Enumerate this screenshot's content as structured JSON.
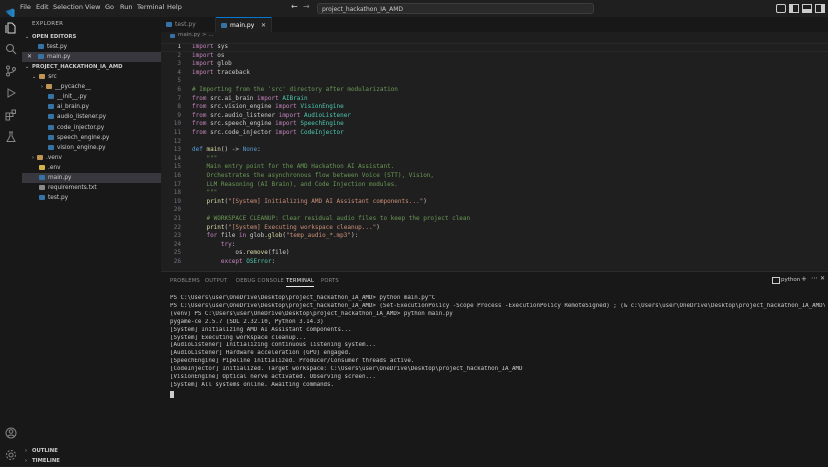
{
  "menu": [
    "File",
    "Edit",
    "Selection",
    "View",
    "Go",
    "Run",
    "Terminal",
    "Help"
  ],
  "search": {
    "text": "project_hackathon_IA_AMD"
  },
  "sidebar": {
    "title": "EXPLORER",
    "open_editors_label": "OPEN EDITORS",
    "open_editors": [
      {
        "label": "test.py",
        "color": "#3572a5"
      },
      {
        "label": "main.py",
        "color": "#3572a5"
      }
    ],
    "project_label": "PROJECT_HACKATHON_IA_AMD",
    "tree": [
      {
        "label": "src",
        "kind": "folder-open",
        "depth": 0
      },
      {
        "label": "__pycache__",
        "kind": "folder",
        "depth": 1
      },
      {
        "label": "__init__.py",
        "kind": "py",
        "depth": 1
      },
      {
        "label": "ai_brain.py",
        "kind": "py",
        "depth": 1
      },
      {
        "label": "audio_listener.py",
        "kind": "py",
        "depth": 1
      },
      {
        "label": "code_injector.py",
        "kind": "py",
        "depth": 1
      },
      {
        "label": "speech_engine.py",
        "kind": "py",
        "depth": 1
      },
      {
        "label": "vision_engine.py",
        "kind": "py",
        "depth": 1
      },
      {
        "label": ".venv",
        "kind": "folder",
        "depth": 0
      },
      {
        "label": ".env",
        "kind": "env",
        "depth": 0
      },
      {
        "label": "main.py",
        "kind": "py",
        "depth": 0
      },
      {
        "label": "requirements.txt",
        "kind": "txt",
        "depth": 0
      },
      {
        "label": "test.py",
        "kind": "py",
        "depth": 0
      }
    ],
    "outline_label": "OUTLINE",
    "timeline_label": "TIMELINE"
  },
  "tabs": [
    {
      "label": "test.py",
      "active": false
    },
    {
      "label": "main.py",
      "active": true
    }
  ],
  "breadcrumb": "main.py > ...",
  "editor": {
    "line_numbers": [
      "1",
      "2",
      "3",
      "4",
      "5",
      "6",
      "7",
      "8",
      "9",
      "10",
      "11",
      "12",
      "13",
      "14",
      "15",
      "16",
      "17",
      "18",
      "19",
      "20",
      "21",
      "22",
      "23",
      "24",
      "25",
      "26"
    ],
    "lines": [
      [
        [
          "import",
          "k"
        ],
        [
          " sys",
          ""
        ]
      ],
      [
        [
          "import",
          "k"
        ],
        [
          " os",
          ""
        ]
      ],
      [
        [
          "import",
          "k"
        ],
        [
          " glob",
          ""
        ]
      ],
      [
        [
          "import",
          "k"
        ],
        [
          " traceback",
          ""
        ]
      ],
      [],
      [
        [
          "# Importing from the 'src' directory after modularization",
          "c"
        ]
      ],
      [
        [
          "from",
          "k"
        ],
        [
          " src.ai_brain ",
          ""
        ],
        [
          "import",
          "k"
        ],
        [
          " AIBrain",
          "t"
        ]
      ],
      [
        [
          "from",
          "k"
        ],
        [
          " src.vision_engine ",
          ""
        ],
        [
          "import",
          "k"
        ],
        [
          " VisionEngine",
          "t"
        ]
      ],
      [
        [
          "from",
          "k"
        ],
        [
          " src.audio_listener ",
          ""
        ],
        [
          "import",
          "k"
        ],
        [
          " AudioListener",
          "t"
        ]
      ],
      [
        [
          "from",
          "k"
        ],
        [
          " src.speech_engine ",
          ""
        ],
        [
          "import",
          "k"
        ],
        [
          " SpeechEngine",
          "t"
        ]
      ],
      [
        [
          "from",
          "k"
        ],
        [
          " src.code_injector ",
          ""
        ],
        [
          "import",
          "k"
        ],
        [
          " CodeInjector",
          "t"
        ]
      ],
      [],
      [
        [
          "def",
          "b"
        ],
        [
          " ",
          ""
        ],
        [
          "main",
          "f"
        ],
        [
          "() -> ",
          ""
        ],
        [
          "None",
          "b"
        ],
        [
          ":",
          ""
        ]
      ],
      [
        [
          "    \"\"\"",
          "c"
        ]
      ],
      [
        [
          "    Main entry point for the AMD Hackathon AI Assistant.",
          "c"
        ]
      ],
      [
        [
          "    Orchestrates the asynchronous flow between Voice (STT), Vision,",
          "c"
        ]
      ],
      [
        [
          "    LLM Reasoning (AI Brain), and Code Injection modules.",
          "c"
        ]
      ],
      [
        [
          "    \"\"\"",
          "c"
        ]
      ],
      [
        [
          "    ",
          ""
        ],
        [
          "print",
          "f"
        ],
        [
          "(",
          ""
        ],
        [
          "\"[System] Initializing AMD AI Assistant components...\"",
          "s"
        ],
        [
          ")",
          ""
        ]
      ],
      [],
      [
        [
          "    # WORKSPACE CLEANUP: Clear residual audio files to keep the project clean",
          "c"
        ]
      ],
      [
        [
          "    ",
          ""
        ],
        [
          "print",
          "f"
        ],
        [
          "(",
          ""
        ],
        [
          "\"[System] Executing workspace cleanup...\"",
          "s"
        ],
        [
          ")",
          ""
        ]
      ],
      [
        [
          "    ",
          ""
        ],
        [
          "for",
          "k"
        ],
        [
          " file ",
          ""
        ],
        [
          "in",
          "k"
        ],
        [
          " glob.",
          ""
        ],
        [
          "glob",
          "f"
        ],
        [
          "(",
          ""
        ],
        [
          "\"temp_audio_*.mp3\"",
          "s"
        ],
        [
          "):",
          ""
        ]
      ],
      [
        [
          "        ",
          ""
        ],
        [
          "try",
          "k"
        ],
        [
          ":",
          ""
        ]
      ],
      [
        [
          "            os.",
          ""
        ],
        [
          "remove",
          "f"
        ],
        [
          "(file)",
          ""
        ]
      ],
      [
        [
          "        ",
          ""
        ],
        [
          "except",
          "k"
        ],
        [
          " ",
          ""
        ],
        [
          "OSError",
          "t"
        ],
        [
          ":",
          ""
        ]
      ]
    ]
  },
  "panel": {
    "tabs": [
      "PROBLEMS",
      "OUTPUT",
      "DEBUG CONSOLE",
      "TERMINAL",
      "PORTS"
    ],
    "active_tab": "TERMINAL",
    "shell_label": "python",
    "terminal": [
      "PS C:\\Users\\user\\OneDrive\\Desktop\\project_hackathon_IA_AMD> python main.py^C",
      "PS C:\\Users\\user\\OneDrive\\Desktop\\project_hackathon_IA_AMD> (Set-ExecutionPolicy -Scope Process -ExecutionPolicy RemoteSigned) ; (& c:\\Users\\user\\OneDrive\\Desktop\\project_hackathon_IA_AMD\\venv\\Scripts\\Ac",
      "(venv) PS C:\\Users\\user\\OneDrive\\Desktop\\project_hackathon_IA_AMD> python main.py",
      "pygame-ce 2.5.7 (SDL 2.32.10, Python 3.14.3)",
      "[System] Initializing AMD AI Assistant components...",
      "[System] Executing workspace cleanup...",
      "[AudioListener] Initializing continuous listening system...",
      "[AudioListener] Hardware acceleration (GPU) engaged.",
      "[SpeechEngine] Pipeline initialized. Producer/Consumer threads active.",
      "[CodeInjector] Initialized. Target workspace: C:\\Users\\user\\OneDrive\\Desktop\\project_hackathon_IA_AMD",
      "[VisionEngine] Optical nerve activated. Observing screen...",
      "[System] All systems online. Awaiting commands."
    ]
  },
  "icons": {
    "activity": [
      "explorer-icon",
      "search-icon",
      "source-control-icon",
      "run-debug-icon",
      "extensions-icon",
      "testing-icon"
    ],
    "bottom": [
      "account-icon",
      "settings-icon"
    ]
  }
}
